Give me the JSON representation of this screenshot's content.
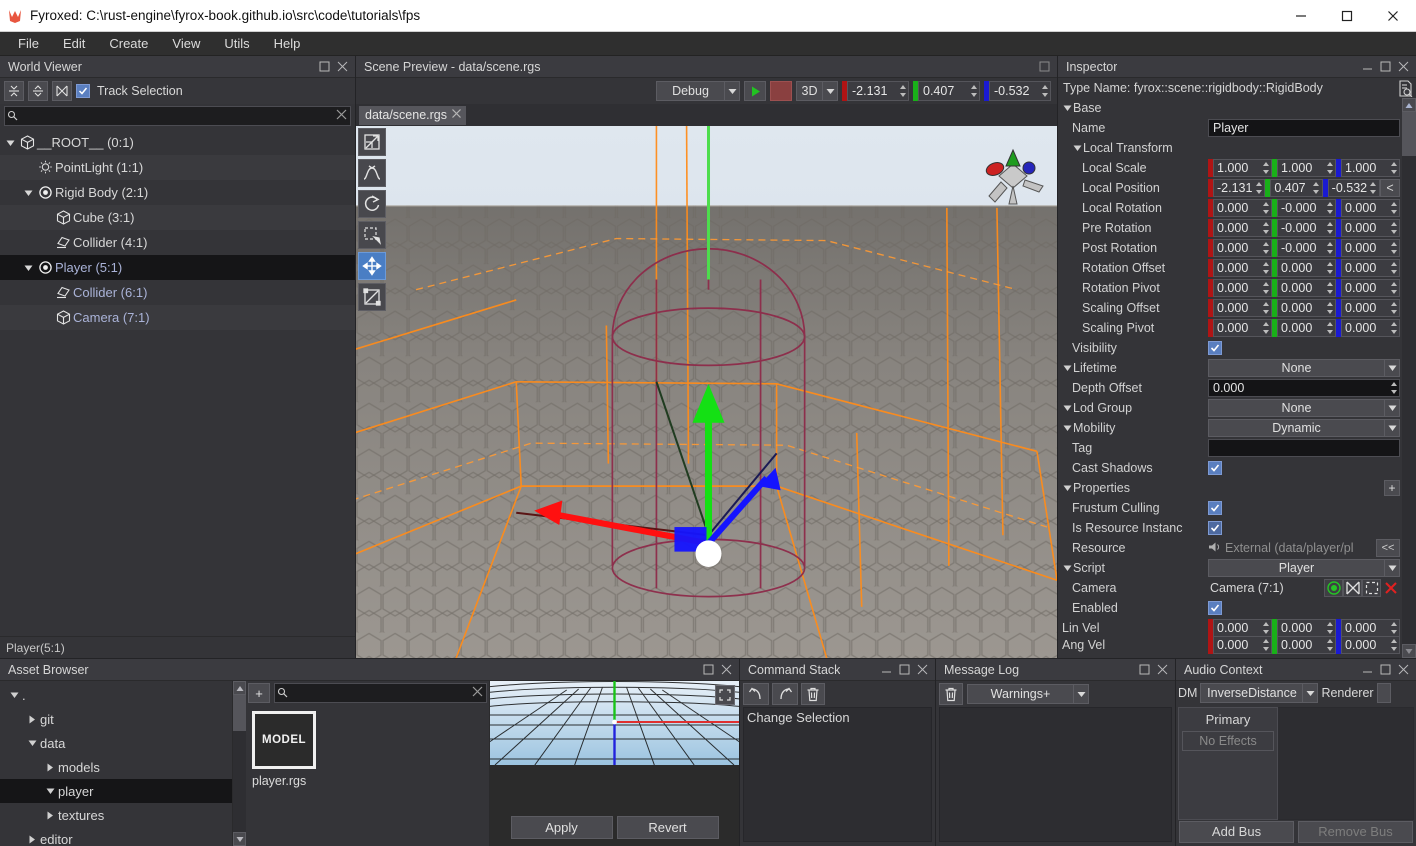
{
  "window": {
    "title": "Fyroxed: C:\\rust-engine\\fyrox-book.github.io\\src\\code\\tutorials\\fps",
    "app_icon": "fyrox-logo-icon",
    "minimize": "minimize-icon",
    "maximize": "maximize-icon",
    "close": "close-icon"
  },
  "menubar": {
    "items": [
      {
        "label": "File"
      },
      {
        "label": "Edit"
      },
      {
        "label": "Create"
      },
      {
        "label": "View"
      },
      {
        "label": "Utils"
      },
      {
        "label": "Help"
      }
    ]
  },
  "world_viewer": {
    "title": "World Viewer",
    "toolbar": {
      "collapse_all": "collapse-all-icon",
      "expand_all": "expand-all-icon",
      "locate_selection": "locate-selection-icon",
      "track_selection_label": "Track Selection",
      "track_selection_checked": true
    },
    "search": {
      "placeholder": "",
      "value": "",
      "icon": "search-icon",
      "clear": "clear-icon"
    },
    "tree": [
      {
        "label": "__ROOT__ (0:1)",
        "indent": 0,
        "icon": "cube-icon",
        "expander": "down",
        "selected": false,
        "child_selected": false
      },
      {
        "label": "PointLight (1:1)",
        "indent": 1,
        "icon": "light-icon",
        "expander": "none",
        "selected": false,
        "child_selected": false
      },
      {
        "label": "Rigid Body (2:1)",
        "indent": 1,
        "icon": "rigidbody-icon",
        "expander": "down",
        "selected": false,
        "child_selected": false
      },
      {
        "label": "Cube (3:1)",
        "indent": 2,
        "icon": "cube-icon",
        "expander": "none",
        "selected": false,
        "child_selected": false
      },
      {
        "label": "Collider (4:1)",
        "indent": 2,
        "icon": "collider-icon",
        "expander": "none",
        "selected": false,
        "child_selected": false
      },
      {
        "label": "Player (5:1)",
        "indent": 1,
        "icon": "rigidbody-icon",
        "expander": "down",
        "selected": true,
        "child_selected": false
      },
      {
        "label": "Collider (6:1)",
        "indent": 2,
        "icon": "collider-icon",
        "expander": "none",
        "selected": false,
        "child_selected": true
      },
      {
        "label": "Camera (7:1)",
        "indent": 2,
        "icon": "cube-icon",
        "expander": "none",
        "selected": false,
        "child_selected": true
      }
    ],
    "status": "Player(5:1)"
  },
  "scene": {
    "title": "Scene Preview - data/scene.rgs",
    "toolbar": {
      "mode_label": "Debug",
      "play": "play-icon",
      "stop": "stop-icon",
      "projection_label": "3D",
      "coords": [
        {
          "axis": "x",
          "value": "-2.131",
          "color": "#b01414"
        },
        {
          "axis": "y",
          "value": "0.407",
          "color": "#19b019"
        },
        {
          "axis": "z",
          "value": "-0.532",
          "color": "#1a1ad2"
        }
      ]
    },
    "tab": {
      "label": "data/scene.rgs",
      "close": "close-icon"
    },
    "viewport_tools": [
      {
        "name": "select-tool",
        "icon": "arrow-select-icon",
        "active": false
      },
      {
        "name": "terrain-tool",
        "icon": "terrain-icon",
        "active": false
      },
      {
        "name": "rotate-tool",
        "icon": "rotate-icon",
        "active": false
      },
      {
        "name": "rect-select-tool",
        "icon": "rect-select-icon",
        "active": false
      },
      {
        "name": "move-tool",
        "icon": "move-icon",
        "active": true
      },
      {
        "name": "scale-tool",
        "icon": "scale-icon",
        "active": false
      }
    ],
    "orientation_gizmo": "orientation-gizmo-icon"
  },
  "inspector": {
    "title": "Inspector",
    "type_name": "Type Name: fyrox::scene::rigidbody::RigidBody",
    "doc_icon": "document-search-icon",
    "sections": [
      {
        "kind": "header",
        "label": "Base",
        "expander": "down"
      },
      {
        "kind": "text",
        "label": "Name",
        "value": "Player",
        "indent": 1
      },
      {
        "kind": "header",
        "label": "Local Transform",
        "expander": "down",
        "indent": 1
      },
      {
        "kind": "vec3",
        "label": "Local Scale",
        "indent": 2,
        "values": [
          "1.000",
          "1.000",
          "1.000"
        ]
      },
      {
        "kind": "vec3",
        "label": "Local Position",
        "indent": 2,
        "values": [
          "-2.131",
          "0.407",
          "-0.532"
        ],
        "extra_button": "<"
      },
      {
        "kind": "vec3",
        "label": "Local Rotation",
        "indent": 2,
        "values": [
          "0.000",
          "-0.000",
          "0.000"
        ]
      },
      {
        "kind": "vec3",
        "label": "Pre Rotation",
        "indent": 2,
        "values": [
          "0.000",
          "-0.000",
          "0.000"
        ]
      },
      {
        "kind": "vec3",
        "label": "Post Rotation",
        "indent": 2,
        "values": [
          "0.000",
          "-0.000",
          "0.000"
        ]
      },
      {
        "kind": "vec3",
        "label": "Rotation Offset",
        "indent": 2,
        "values": [
          "0.000",
          "0.000",
          "0.000"
        ]
      },
      {
        "kind": "vec3",
        "label": "Rotation Pivot",
        "indent": 2,
        "values": [
          "0.000",
          "0.000",
          "0.000"
        ]
      },
      {
        "kind": "vec3",
        "label": "Scaling Offset",
        "indent": 2,
        "values": [
          "0.000",
          "0.000",
          "0.000"
        ]
      },
      {
        "kind": "vec3",
        "label": "Scaling Pivot",
        "indent": 2,
        "values": [
          "0.000",
          "0.000",
          "0.000"
        ]
      },
      {
        "kind": "check",
        "label": "Visibility",
        "indent": 1,
        "checked": true
      },
      {
        "kind": "dropdown",
        "label": "Lifetime",
        "expander": "down",
        "indent": 0,
        "value": "None"
      },
      {
        "kind": "number",
        "label": "Depth Offset",
        "indent": 1,
        "value": "0.000"
      },
      {
        "kind": "dropdown",
        "label": "Lod Group",
        "expander": "down",
        "indent": 0,
        "value": "None"
      },
      {
        "kind": "dropdown",
        "label": "Mobility",
        "expander": "down",
        "indent": 0,
        "value": "Dynamic"
      },
      {
        "kind": "text",
        "label": "Tag",
        "indent": 1,
        "value": ""
      },
      {
        "kind": "check",
        "label": "Cast Shadows",
        "indent": 1,
        "checked": true
      },
      {
        "kind": "header_plus",
        "label": "Properties",
        "expander": "down",
        "indent": 0,
        "plus": "+"
      },
      {
        "kind": "check",
        "label": "Frustum Culling",
        "indent": 1,
        "checked": true
      },
      {
        "kind": "check",
        "label": "Is Resource Instanc",
        "indent": 1,
        "checked": true,
        "faded": true
      },
      {
        "kind": "resource",
        "label": "Resource",
        "indent": 1,
        "value": "External (data/player/pl",
        "icon": "speaker-icon",
        "button": "<<"
      },
      {
        "kind": "dropdown",
        "label": "Script",
        "expander": "down",
        "indent": 0,
        "value": "Player"
      },
      {
        "kind": "noderef",
        "label": "Camera",
        "indent": 1,
        "value": "Camera (7:1)",
        "buttons": [
          "record-icon",
          "locate-icon",
          "select-icon",
          "clear-icon"
        ]
      },
      {
        "kind": "check",
        "label": "Enabled",
        "indent": 1,
        "checked": true
      },
      {
        "kind": "vec3",
        "label": "Lin Vel",
        "indent": 0,
        "values": [
          "0.000",
          "0.000",
          "0.000"
        ]
      },
      {
        "kind": "vec3",
        "label": "Ang Vel",
        "indent": 0,
        "values": [
          "0.000",
          "0.000",
          "0.000"
        ],
        "clipped": true
      }
    ]
  },
  "asset_browser": {
    "title": "Asset Browser",
    "tree": [
      {
        "label": ".",
        "indent": 0,
        "expander": "down",
        "selected": false
      },
      {
        "label": "git",
        "indent": 1,
        "expander": "right",
        "selected": false
      },
      {
        "label": "data",
        "indent": 1,
        "expander": "down",
        "selected": false
      },
      {
        "label": "models",
        "indent": 2,
        "expander": "right",
        "selected": false
      },
      {
        "label": "player",
        "indent": 2,
        "expander": "down",
        "selected": true
      },
      {
        "label": "textures",
        "indent": 2,
        "expander": "right",
        "selected": false
      },
      {
        "label": "editor",
        "indent": 1,
        "expander": "right",
        "selected": false
      }
    ],
    "toolbar": {
      "add": "+",
      "search_placeholder": "",
      "search_value": "",
      "search_icon": "search-icon",
      "clear_icon": "clear-icon"
    },
    "items": [
      {
        "name": "player.rgs",
        "type_label": "MODEL"
      }
    ],
    "preview": {
      "fullscreen_icon": "fullscreen-icon",
      "apply_label": "Apply",
      "revert_label": "Revert"
    }
  },
  "command_stack": {
    "title": "Command Stack",
    "tools": [
      {
        "name": "undo-button",
        "icon": "undo-icon"
      },
      {
        "name": "redo-button",
        "icon": "redo-icon"
      },
      {
        "name": "clear-button",
        "icon": "trash-icon"
      }
    ],
    "items": [
      "Change Selection"
    ]
  },
  "message_log": {
    "title": "Message Log",
    "clear_icon": "trash-icon",
    "filter_value": "Warnings+",
    "items": []
  },
  "audio_context": {
    "title": "Audio Context",
    "dm_label": "DM",
    "dm_value": "InverseDistance",
    "renderer_label": "Renderer",
    "buses": [
      {
        "name": "Primary",
        "effects": "No Effects"
      }
    ],
    "add_bus_label": "Add Bus",
    "remove_bus_label": "Remove Bus"
  },
  "colors": {
    "accent_blue": "#4a7ec4",
    "axis_x": "#b01414",
    "axis_y": "#19b019",
    "axis_z": "#1a1ad2",
    "panel_bg": "#343438",
    "head_bg": "#3b3b40",
    "selection_bg": "#151517"
  }
}
